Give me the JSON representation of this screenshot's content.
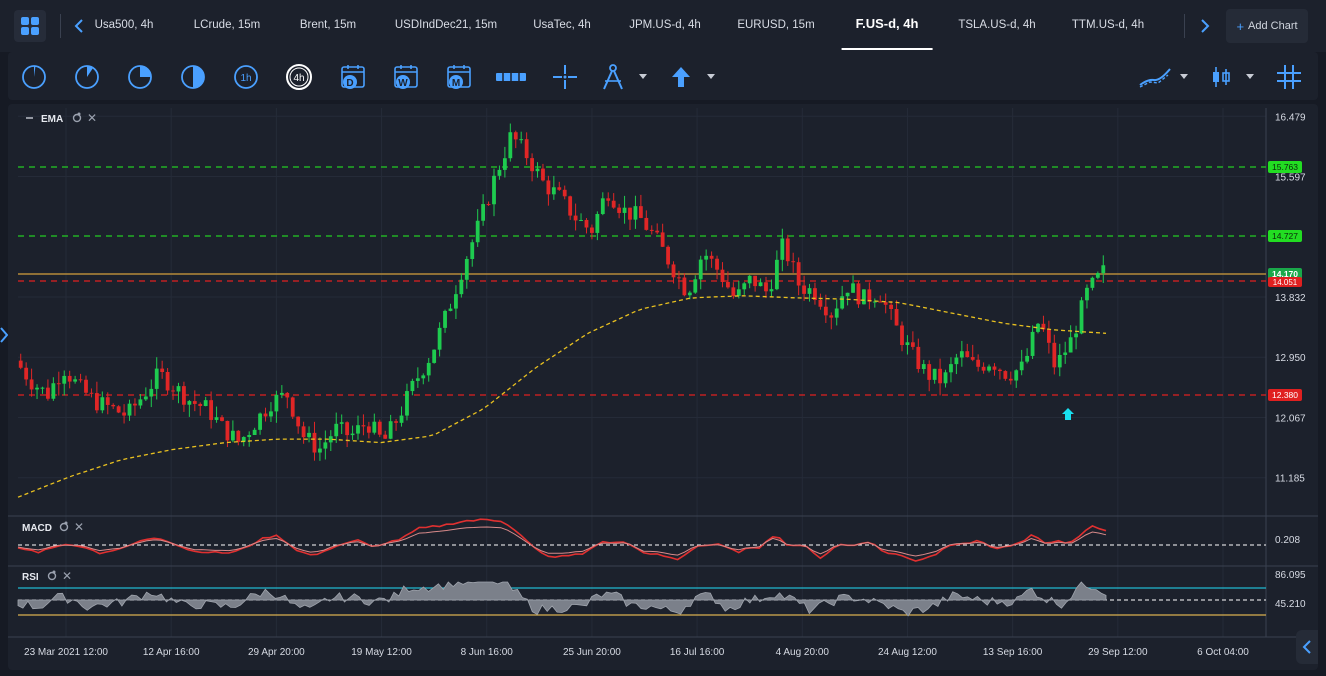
{
  "tabs": [
    {
      "label": "Usa500, 4h",
      "active": false
    },
    {
      "label": "LCrude, 15m",
      "active": false
    },
    {
      "label": "Brent, 15m",
      "active": false
    },
    {
      "label": "USDIndDec21, 15m",
      "active": false
    },
    {
      "label": "UsaTec, 4h",
      "active": false
    },
    {
      "label": "JPM.US-d, 4h",
      "active": false
    },
    {
      "label": "EURUSD, 15m",
      "active": false
    },
    {
      "label": "F.US-d, 4h",
      "active": true
    },
    {
      "label": "TSLA.US-d, 4h",
      "active": false
    },
    {
      "label": "TTM.US-d, 4h",
      "active": false
    }
  ],
  "add_chart_label": "Add Chart",
  "toolbar": {
    "timeframe_icons": [
      "m1-icon",
      "m5-icon",
      "m15-icon",
      "m30-icon",
      "h1-icon",
      "h4-icon"
    ],
    "h1_label": "1h",
    "h4_label": "4h",
    "calendar_labels": [
      "D",
      "W",
      "M"
    ],
    "drawing_icons": [
      "ruler-icon",
      "crosshair-icon",
      "compass-icon",
      "arrow-up-icon"
    ],
    "right_icons": [
      "indicators-icon",
      "candle-type-icon",
      "grid-icon"
    ]
  },
  "accent_color": "#4aa0ff",
  "chart_data": {
    "type": "candlestick",
    "main_label": "EMA",
    "price_axis": [
      "16.479",
      "15.597",
      "13.832",
      "12.950",
      "12.067",
      "11.185"
    ],
    "ylim": [
      10.8,
      16.6
    ],
    "price_tags": [
      {
        "value": "15.763",
        "color": "#22dd22"
      },
      {
        "value": "14.727",
        "color": "#22dd22"
      },
      {
        "value": "14.170",
        "color": "#1aa84a"
      },
      {
        "value": "14.051",
        "color": "#e02020"
      },
      {
        "value": "12.380",
        "color": "#e02020"
      }
    ],
    "time_axis": [
      "23 Mar 2021 12:00",
      "12 Apr 16:00",
      "29 Apr 20:00",
      "19 May 12:00",
      "8 Jun 16:00",
      "25 Jun 20:00",
      "16 Jul 16:00",
      "4 Aug 20:00",
      "24 Aug 12:00",
      "13 Sep 16:00",
      "29 Sep 12:00",
      "6 Oct 04:00"
    ],
    "close_path": [
      12.9,
      12.6,
      12.4,
      12.8,
      12.5,
      12.3,
      12.2,
      12.1,
      12.4,
      12.7,
      12.5,
      12.3,
      12.2,
      11.9,
      11.7,
      12.0,
      12.3,
      12.4,
      11.8,
      11.6,
      11.9,
      11.8,
      12.0,
      11.7,
      12.1,
      12.6,
      13.0,
      13.6,
      14.3,
      14.9,
      15.6,
      16.2,
      15.9,
      15.5,
      15.3,
      15.0,
      14.8,
      15.4,
      15.1,
      15.0,
      14.7,
      14.3,
      13.9,
      14.5,
      14.2,
      13.8,
      14.1,
      13.9,
      14.6,
      14.0,
      13.9,
      13.6,
      14.0,
      13.8,
      13.9,
      13.4,
      13.0,
      12.7,
      12.6,
      13.0,
      12.8,
      12.9,
      12.7,
      12.8,
      13.5,
      12.8,
      13.2,
      13.9,
      14.2
    ],
    "ema_path": [
      10.9,
      11.2,
      11.45,
      11.6,
      11.7,
      11.75,
      11.75,
      11.7,
      11.8,
      12.2,
      12.8,
      13.3,
      13.65,
      13.82,
      13.85,
      13.82,
      13.8,
      13.75,
      13.6,
      13.45,
      13.35,
      13.3
    ],
    "up_arrow_marker": "cyan",
    "macd": {
      "label": "MACD",
      "level": "0.208"
    },
    "rsi": {
      "label": "RSI",
      "levels": [
        "86.095",
        "45.210"
      ]
    }
  }
}
